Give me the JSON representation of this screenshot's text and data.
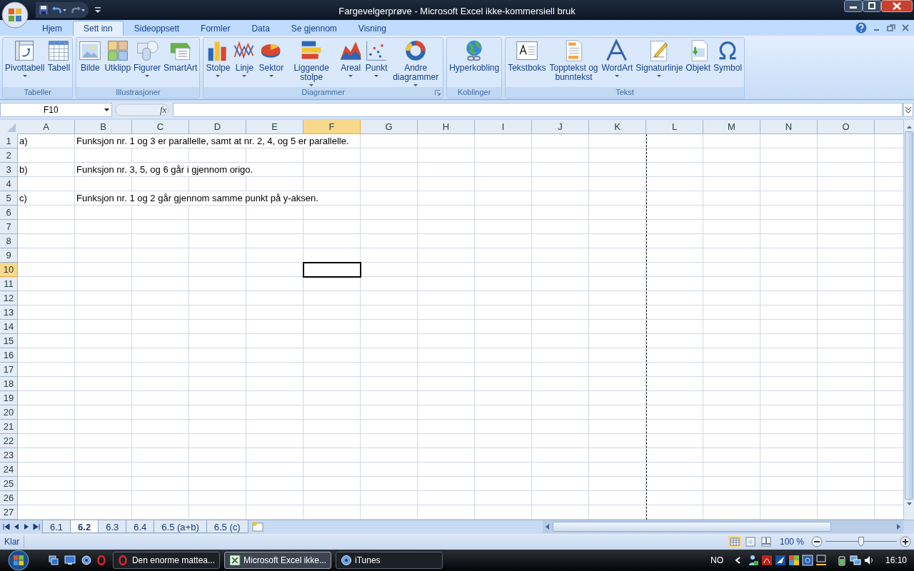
{
  "window": {
    "title": "Fargevelgerprøve - Microsoft Excel ikke-kommersiell bruk"
  },
  "ribbon": {
    "tabs": [
      {
        "label": "Hjem",
        "selected": false
      },
      {
        "label": "Sett inn",
        "selected": true
      },
      {
        "label": "Sideoppsett",
        "selected": false
      },
      {
        "label": "Formler",
        "selected": false
      },
      {
        "label": "Data",
        "selected": false
      },
      {
        "label": "Se gjennom",
        "selected": false
      },
      {
        "label": "Visning",
        "selected": false
      }
    ],
    "groups": [
      {
        "label": "Tabeller",
        "launcher": false,
        "buttons": [
          {
            "label": "Pivottabell",
            "dropdown": true
          },
          {
            "label": "Tabell",
            "dropdown": false
          }
        ]
      },
      {
        "label": "Illustrasjoner",
        "launcher": false,
        "buttons": [
          {
            "label": "Bilde",
            "dropdown": false
          },
          {
            "label": "Utklipp",
            "dropdown": false
          },
          {
            "label": "Figurer",
            "dropdown": true
          },
          {
            "label": "SmartArt",
            "dropdown": false
          }
        ]
      },
      {
        "label": "Diagrammer",
        "launcher": true,
        "buttons": [
          {
            "label": "Stolpe",
            "dropdown": true
          },
          {
            "label": "Linje",
            "dropdown": true
          },
          {
            "label": "Sektor",
            "dropdown": true
          },
          {
            "label": "Liggende stolpe",
            "dropdown": true
          },
          {
            "label": "Areal",
            "dropdown": true
          },
          {
            "label": "Punkt",
            "dropdown": true
          },
          {
            "label": "Andre diagrammer",
            "dropdown": true
          }
        ]
      },
      {
        "label": "Koblinger",
        "launcher": false,
        "buttons": [
          {
            "label": "Hyperkobling",
            "dropdown": false
          }
        ]
      },
      {
        "label": "Tekst",
        "launcher": false,
        "buttons": [
          {
            "label": "Tekstboks",
            "dropdown": false
          },
          {
            "label": "Topptekst og bunntekst",
            "dropdown": false
          },
          {
            "label": "WordArt",
            "dropdown": true
          },
          {
            "label": "Signaturlinje",
            "dropdown": true
          },
          {
            "label": "Objekt",
            "dropdown": false
          },
          {
            "label": "Symbol",
            "dropdown": false
          }
        ]
      }
    ]
  },
  "formula_bar": {
    "name_box": "F10",
    "function_label": "fx"
  },
  "sheet": {
    "columns": [
      {
        "label": "A",
        "selected": false
      },
      {
        "label": "B",
        "selected": false
      },
      {
        "label": "C",
        "selected": false
      },
      {
        "label": "D",
        "selected": false
      },
      {
        "label": "E",
        "selected": false
      },
      {
        "label": "F",
        "selected": true
      },
      {
        "label": "G",
        "selected": false
      },
      {
        "label": "H",
        "selected": false
      },
      {
        "label": "I",
        "selected": false
      },
      {
        "label": "J",
        "selected": false
      },
      {
        "label": "K",
        "selected": false
      },
      {
        "label": "L",
        "selected": false
      },
      {
        "label": "M",
        "selected": false
      },
      {
        "label": "N",
        "selected": false
      },
      {
        "label": "O",
        "selected": false
      }
    ],
    "rows": [
      {
        "label": "1",
        "selected": false,
        "cells": [
          "a)",
          "Funksjon nr. 1 og 3 er parallelle, samt at nr. 2, 4, og 5 er parallelle."
        ]
      },
      {
        "label": "2",
        "selected": false
      },
      {
        "label": "3",
        "selected": false,
        "cells": [
          "b)",
          "Funksjon nr. 3, 5, og 6 går i gjennom origo."
        ]
      },
      {
        "label": "4",
        "selected": false
      },
      {
        "label": "5",
        "selected": false,
        "cells": [
          "c)",
          "Funksjon nr. 1 og 2 går gjennom samme punkt på y-aksen."
        ]
      },
      {
        "label": "6",
        "selected": false
      },
      {
        "label": "7",
        "selected": false
      },
      {
        "label": "8",
        "selected": false
      },
      {
        "label": "9",
        "selected": false
      },
      {
        "label": "10",
        "selected": true
      },
      {
        "label": "11",
        "selected": false
      },
      {
        "label": "12",
        "selected": false
      },
      {
        "label": "13",
        "selected": false
      },
      {
        "label": "14",
        "selected": false
      },
      {
        "label": "15",
        "selected": false
      },
      {
        "label": "16",
        "selected": false
      },
      {
        "label": "17",
        "selected": false
      },
      {
        "label": "18",
        "selected": false
      },
      {
        "label": "19",
        "selected": false
      },
      {
        "label": "20",
        "selected": false
      },
      {
        "label": "21",
        "selected": false
      },
      {
        "label": "22",
        "selected": false
      },
      {
        "label": "23",
        "selected": false
      },
      {
        "label": "24",
        "selected": false
      },
      {
        "label": "25",
        "selected": false
      },
      {
        "label": "26",
        "selected": false
      },
      {
        "label": "27",
        "selected": false
      }
    ]
  },
  "sheet_tabs": [
    {
      "label": "6.1",
      "selected": false
    },
    {
      "label": "6.2",
      "selected": true
    },
    {
      "label": "6.3",
      "selected": false
    },
    {
      "label": "6.4",
      "selected": false
    },
    {
      "label": "6.5 (a+b)",
      "selected": false
    },
    {
      "label": "6.5 (c)",
      "selected": false
    }
  ],
  "status_bar": {
    "status": "Klar",
    "zoom": "100 %",
    "zoom_slider": {
      "level": 0.5
    }
  },
  "taskbar": {
    "tasks": [
      {
        "label": "Den enorme mattea...",
        "selected": false
      },
      {
        "label": "Microsoft Excel ikke...",
        "selected": true
      },
      {
        "label": "iTunes",
        "selected": false
      }
    ],
    "language": "NO",
    "clock": "16:10"
  }
}
